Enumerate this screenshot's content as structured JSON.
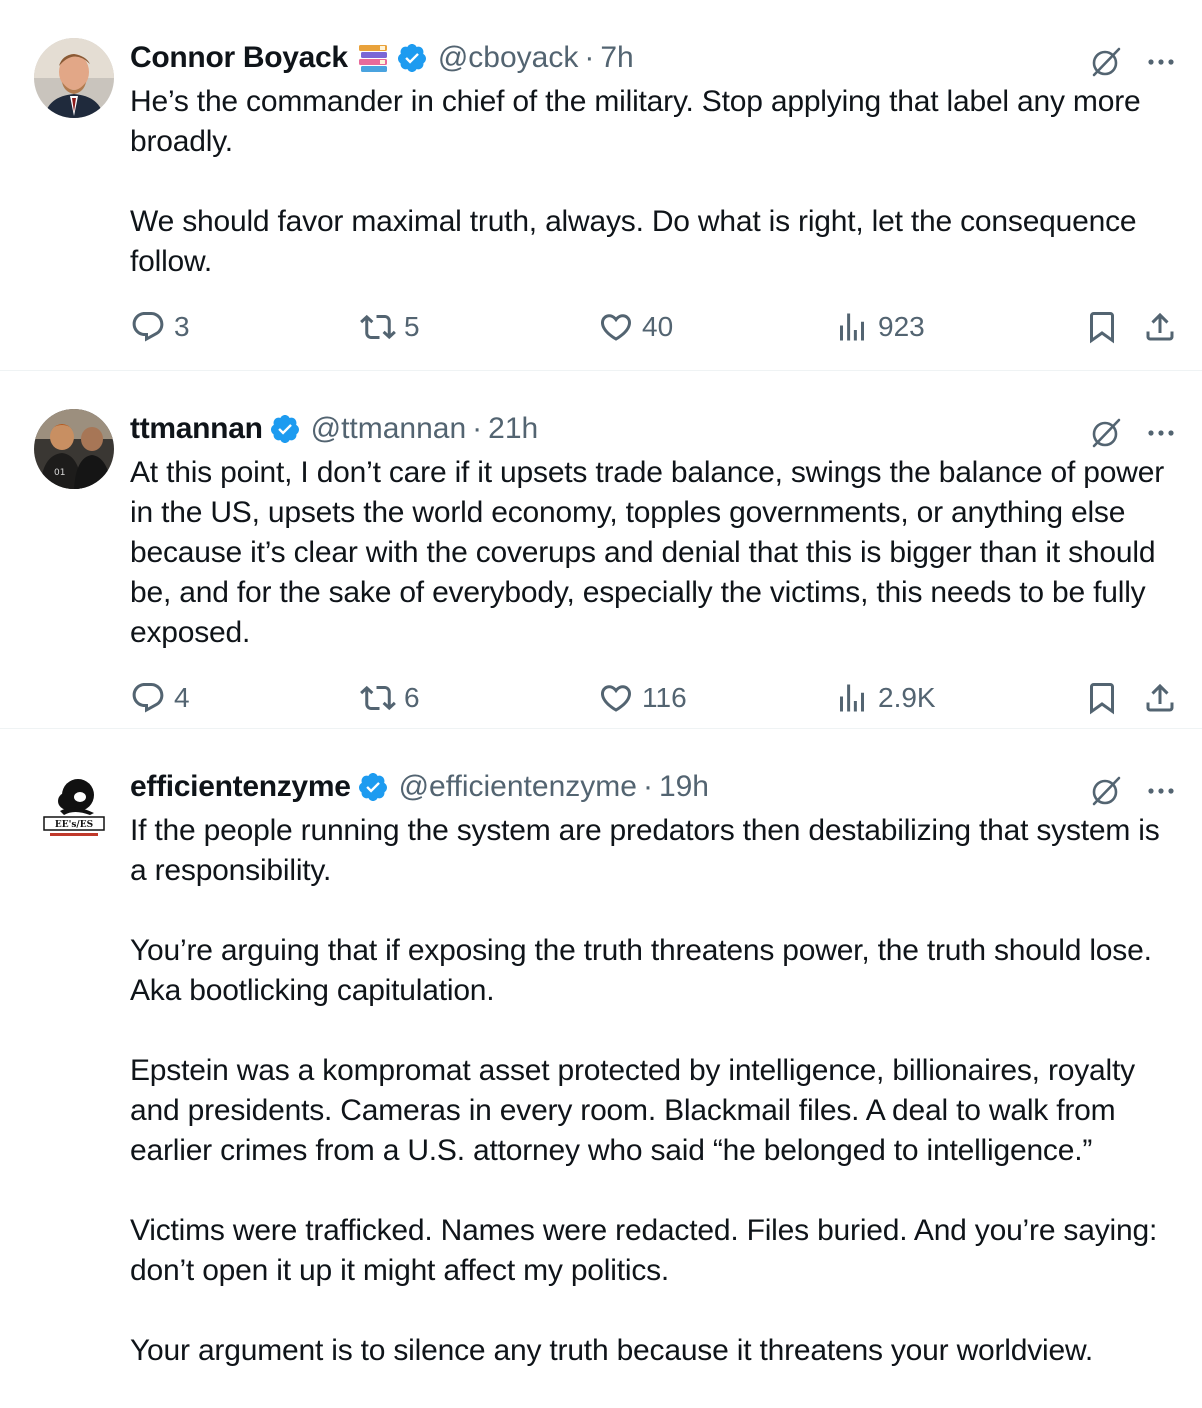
{
  "colors": {
    "text": "#0f1419",
    "secondary": "#536471",
    "verified": "#1d9bf0",
    "divider": "#eff3f4"
  },
  "tweets": [
    {
      "avatar_icon": "person-avatar",
      "name": "Connor Boyack",
      "has_emoji": true,
      "emoji_icon": "books-emoji",
      "verified": true,
      "handle": "@cboyack",
      "dot": "·",
      "time": "7h",
      "paragraphs": [
        "He’s the commander in chief of the military. Stop applying that label any more broadly.",
        "We should favor maximal truth, always. Do what is right, let the consequence follow."
      ],
      "replies": "3",
      "retweets": "5",
      "likes": "40",
      "views": "923"
    },
    {
      "avatar_icon": "group-photo-avatar",
      "name": "ttmannan",
      "has_emoji": false,
      "verified": true,
      "handle": "@ttmannan",
      "dot": "·",
      "time": "21h",
      "paragraphs": [
        "At this point, I don’t care if it upsets trade balance, swings the balance of power in the US, upsets the world economy, topples governments, or anything else because it’s clear with the coverups and denial that this is bigger than it should be, and for the sake of everybody, especially the victims, this needs to be fully exposed."
      ],
      "replies": "4",
      "retweets": "6",
      "likes": "116",
      "views": "2.9K"
    },
    {
      "avatar_icon": "ee-es-logo-avatar",
      "avatar_text": "EE's/ES",
      "name": "efficientenzyme",
      "has_emoji": false,
      "verified": true,
      "handle": "@efficientenzyme",
      "dot": "·",
      "time": "19h",
      "paragraphs": [
        "If the people running the system are predators then destabilizing that system is a responsibility.",
        "You’re arguing that if exposing the truth threatens power, the truth should lose. Aka bootlicking capitulation.",
        "Epstein was a kompromat asset protected by intelligence, billionaires, royalty and presidents. Cameras in every room. Blackmail files. A deal to walk from earlier crimes from a U.S. attorney who said “he belonged to intelligence.”",
        "Victims were trafficked. Names were redacted. Files buried. And you’re saying: don’t open it up it might affect my politics.",
        "Your argument is to silence any truth because it threatens your worldview."
      ]
    }
  ]
}
